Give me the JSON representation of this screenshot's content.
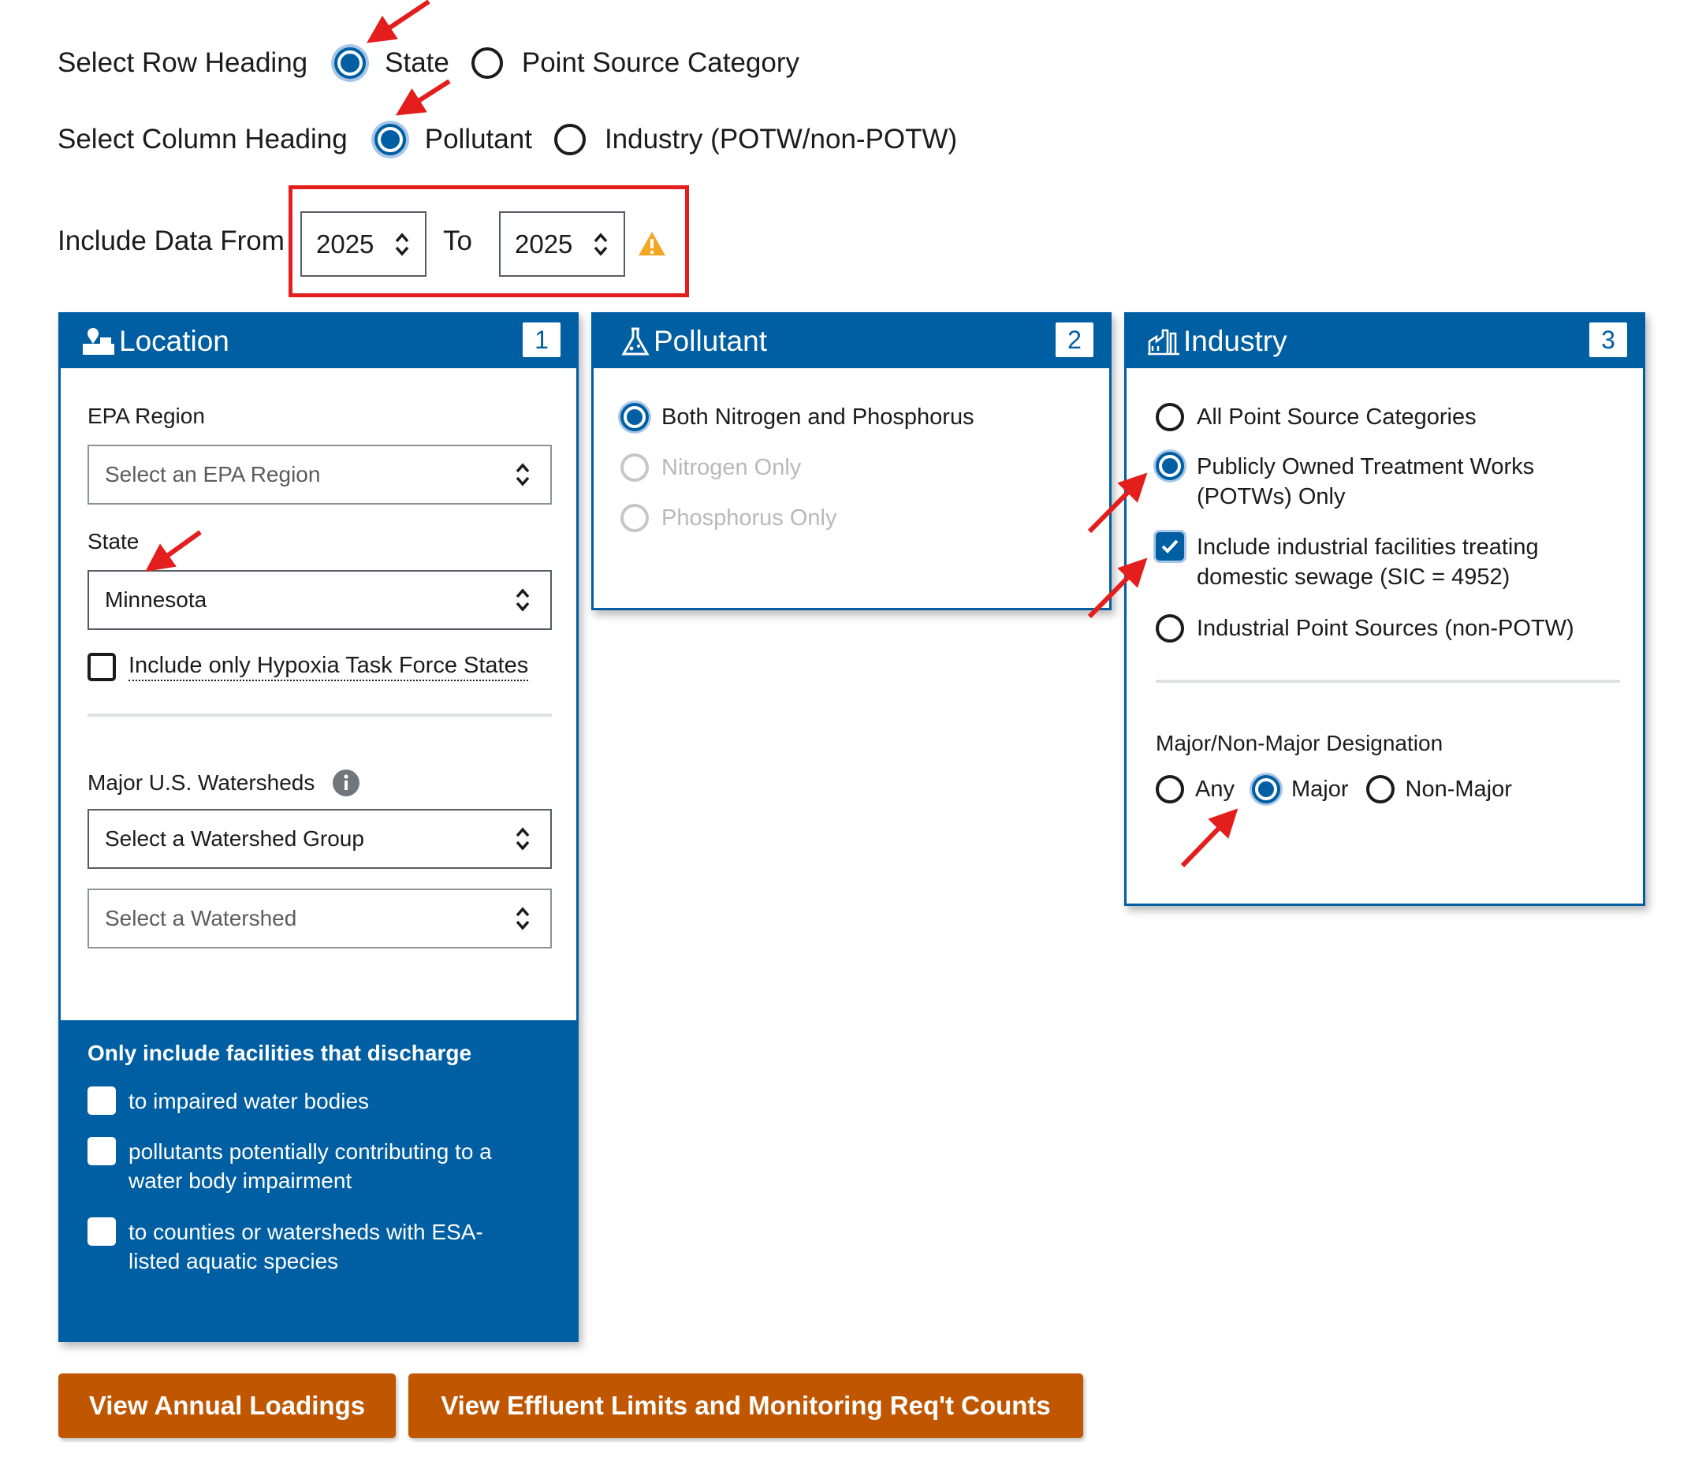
{
  "row_heading": {
    "label": "Select Row Heading",
    "options": [
      "State",
      "Point Source Category"
    ],
    "selected": "State"
  },
  "column_heading": {
    "label": "Select Column Heading",
    "options": [
      "Pollutant",
      "Industry (POTW/non-POTW)"
    ],
    "selected": "Pollutant"
  },
  "data_range": {
    "label": "Include Data From",
    "from": "2025",
    "to_label": "To",
    "to": "2025",
    "warning_icon": "warning-triangle-icon"
  },
  "location": {
    "title": "Location",
    "number": "1",
    "icon": "location-map-icon",
    "epa_region_label": "EPA Region",
    "epa_region_placeholder": "Select an EPA Region",
    "state_label": "State",
    "state_value": "Minnesota",
    "hypoxia_label": "Include only Hypoxia Task Force States",
    "watersheds_label": "Major U.S. Watersheds",
    "info_icon": "info-icon",
    "watershed_group_value": "Select a Watershed Group",
    "watershed_placeholder": "Select a Watershed",
    "discharge": {
      "heading": "Only include facilities that discharge",
      "options": [
        "to impaired water bodies",
        "pollutants potentially contributing to a water body impairment",
        "to counties or watersheds with ESA-listed aquatic species"
      ]
    }
  },
  "pollutant": {
    "title": "Pollutant",
    "number": "2",
    "icon": "flask-icon",
    "options": [
      "Both Nitrogen and Phosphorus",
      "Nitrogen Only",
      "Phosphorus Only"
    ],
    "selected": "Both Nitrogen and Phosphorus"
  },
  "industry": {
    "title": "Industry",
    "number": "3",
    "icon": "factory-icon",
    "options": {
      "all": "All Point Source Categories",
      "potw": "Publicly Owned Treatment Works (POTWs) Only",
      "include_industrial": "Include industrial facilities treating domestic sewage (SIC = 4952)",
      "non_potw": "Industrial Point Sources (non-POTW)"
    },
    "selected": "Publicly Owned Treatment Works (POTWs) Only",
    "include_industrial_checked": true,
    "designation_label": "Major/Non-Major Designation",
    "designation_options": [
      "Any",
      "Major",
      "Non-Major"
    ],
    "designation_selected": "Major"
  },
  "buttons": {
    "annual": "View Annual Loadings",
    "effluent": "View Effluent Limits and Monitoring Req't Counts"
  },
  "colors": {
    "primary": "#005ea2",
    "button": "#c05600",
    "annotation": "#e41d1d"
  }
}
